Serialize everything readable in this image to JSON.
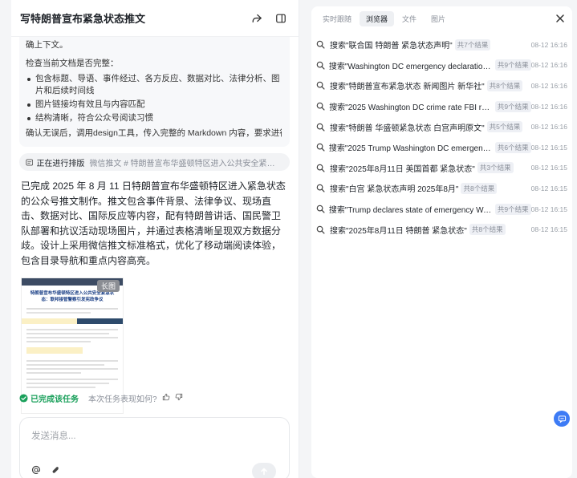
{
  "left": {
    "title": "写特朗普宣布紧急状态推文",
    "think": {
      "top_line": "确上下文。",
      "check_line": "检查当前文档是否完整：",
      "bullets": [
        "包含标题、导语、事件经过、各方反应、数据对比、法律分析、图片和后续时间线",
        "图片链接均有效且与内容匹配",
        "结构清晰，符合公众号阅读习惯"
      ],
      "confirm": "确认无误后，调用design工具，传入完整的 Markdown 内容，要求进行公众号推"
    },
    "step": {
      "label": "正在进行排版",
      "detail": "微信推文 # 特朗普宣布华盛顿特区进入公共安全紧急状态：联..."
    },
    "answer": "已完成 2025 年 8 月 11 日特朗普宣布华盛顿特区进入紧急状态的公众号推文制作。推文包含事件背景、法律争议、现场直击、数据对比、国际反应等内容，配有特朗普讲话、国民警卫队部署和抗议活动现场图片，并通过表格清晰呈现双方数据分歧。设计上采用微信推文标准格式，优化了移动端阅读体验，包含目录导航和重点内容高亮。",
    "preview": {
      "tag": "长图",
      "doc_title": "特朗普宣布华盛顿特区进入公共安全紧急状态：联邦接管警察引发宪政争议"
    },
    "done_label": "已完成该任务",
    "feedback_question": "本次任务表现如何?",
    "input_placeholder": "发送消息..."
  },
  "right": {
    "tabs": [
      {
        "label": "实时跟随",
        "active": false
      },
      {
        "label": "浏览器",
        "active": true
      },
      {
        "label": "文件",
        "active": false
      },
      {
        "label": "图片",
        "active": false
      }
    ],
    "results": [
      {
        "query": "搜索\"联合国 特朗普 紧急状态声明\"",
        "count": "共7个结果",
        "time": "08-12 16:16"
      },
      {
        "query": "搜索\"Washington DC emergency declaration lat...\"",
        "count": "共9个结果",
        "time": "08-12 16:16"
      },
      {
        "query": "搜索\"特朗普宣布紧急状态 新闻图片 新华社\"",
        "count": "共8个结果",
        "time": "08-12 16:16"
      },
      {
        "query": "搜索\"2025 Washington DC crime rate FBI report\"",
        "count": "共9个结果",
        "time": "08-12 16:16"
      },
      {
        "query": "搜索\"特朗普 华盛顿紧急状态 白宫声明原文\"",
        "count": "共5个结果",
        "time": "08-12 16:16"
      },
      {
        "query": "搜索\"2025 Trump Washington DC emergency d...\"",
        "count": "共6个结果",
        "time": "08-12 16:15"
      },
      {
        "query": "搜索\"2025年8月11日 美国首都 紧急状态\"",
        "count": "共3个结果",
        "time": "08-12 16:15"
      },
      {
        "query": "搜索\"白宫 紧急状态声明 2025年8月\"",
        "count": "共8个结果",
        "time": "08-12 16:15"
      },
      {
        "query": "搜索\"Trump declares state of emergency Washi...\"",
        "count": "共9个结果",
        "time": "08-12 16:15"
      },
      {
        "query": "搜索\"2025年8月11日 特朗普 紧急状态\"",
        "count": "共8个结果",
        "time": "08-12 16:15"
      }
    ]
  },
  "colors": {
    "accent": "#3d7bf5",
    "success": "#1aa05b"
  }
}
